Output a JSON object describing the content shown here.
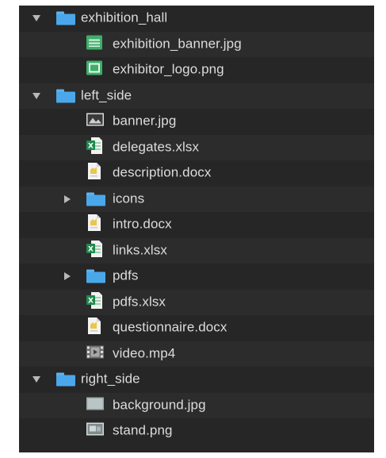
{
  "tree": {
    "rows": [
      {
        "label": "exhibition_hall",
        "kind": "folder",
        "level": 0,
        "expanded": true
      },
      {
        "label": "exhibition_banner.jpg",
        "kind": "image-green",
        "level": 1
      },
      {
        "label": "exhibitor_logo.png",
        "kind": "image-green-frame",
        "level": 1
      },
      {
        "label": "left_side",
        "kind": "folder",
        "level": 0,
        "expanded": true
      },
      {
        "label": "banner.jpg",
        "kind": "image-dark",
        "level": 1
      },
      {
        "label": "delegates.xlsx",
        "kind": "xlsx",
        "level": 1
      },
      {
        "label": "description.docx",
        "kind": "docx",
        "level": 1
      },
      {
        "label": "icons",
        "kind": "folder",
        "level": 1,
        "expanded": false
      },
      {
        "label": "intro.docx",
        "kind": "docx",
        "level": 1
      },
      {
        "label": "links.xlsx",
        "kind": "xlsx",
        "level": 1
      },
      {
        "label": "pdfs",
        "kind": "folder",
        "level": 1,
        "expanded": false
      },
      {
        "label": "pdfs.xlsx",
        "kind": "xlsx",
        "level": 1
      },
      {
        "label": "questionnaire.docx",
        "kind": "docx",
        "level": 1
      },
      {
        "label": "video.mp4",
        "kind": "video",
        "level": 1
      },
      {
        "label": "right_side",
        "kind": "folder",
        "level": 0,
        "expanded": true
      },
      {
        "label": "background.jpg",
        "kind": "image-gray",
        "level": 1
      },
      {
        "label": "stand.png",
        "kind": "image-stand",
        "level": 1
      }
    ]
  },
  "colors": {
    "panel_bg": "#262626",
    "row_alt_bg": "#2c2c2c",
    "text": "#dcdcdc",
    "folder": "#4aa8ea",
    "image_green": "#3fae6a",
    "excel_green": "#1f8a4c",
    "doc_yellow": "#e9c74a"
  }
}
